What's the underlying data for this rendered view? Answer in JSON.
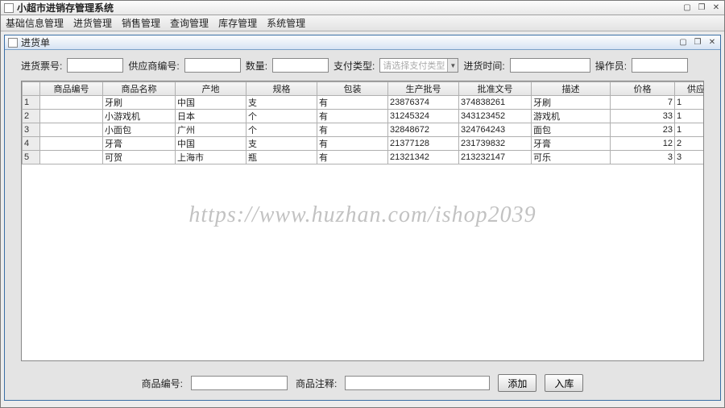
{
  "window": {
    "title": "小超市进销存管理系统",
    "min_icon": "▢",
    "restore_icon": "❐",
    "close_icon": "✕"
  },
  "menubar": {
    "items": [
      "基础信息管理",
      "进货管理",
      "销售管理",
      "查询管理",
      "库存管理",
      "系统管理"
    ]
  },
  "subwindow": {
    "title": "进货单",
    "min_icon": "▢",
    "restore_icon": "❐",
    "close_icon": "✕"
  },
  "filters": {
    "jinhuo_piaohao_label": "进货票号:",
    "jinhuo_piaohao": "",
    "gys_bianhao_label": "供应商编号:",
    "gys_bianhao": "",
    "shuliang_label": "数量:",
    "shuliang": "",
    "zhifu_leixing_label": "支付类型:",
    "zhifu_leixing_placeholder": "请选择支付类型",
    "jinhuo_shijian_label": "进货时间:",
    "jinhuo_shijian": "",
    "caozuoyuan_label": "操作员:",
    "caozuoyuan": ""
  },
  "table": {
    "columns": [
      "商品编号",
      "商品名称",
      "产地",
      "规格",
      "包装",
      "生产批号",
      "批准文号",
      "描述",
      "价格",
      "供应商编号"
    ],
    "rows": [
      {
        "n": "1",
        "id": "",
        "name": "牙刷",
        "origin": "中国",
        "spec": "支",
        "pack": "有",
        "batch": "23876374",
        "approve": "374838261",
        "desc": "牙刷",
        "price": "7",
        "supplier": "1"
      },
      {
        "n": "2",
        "id": "",
        "name": "小游戏机",
        "origin": "日本",
        "spec": "个",
        "pack": "有",
        "batch": "31245324",
        "approve": "343123452",
        "desc": "游戏机",
        "price": "33",
        "supplier": "1"
      },
      {
        "n": "3",
        "id": "",
        "name": "小面包",
        "origin": "广州",
        "spec": "个",
        "pack": "有",
        "batch": "32848672",
        "approve": "324764243",
        "desc": "面包",
        "price": "23",
        "supplier": "1"
      },
      {
        "n": "4",
        "id": "",
        "name": "牙膏",
        "origin": "中国",
        "spec": "支",
        "pack": "有",
        "batch": "21377128",
        "approve": "231739832",
        "desc": "牙膏",
        "price": "12",
        "supplier": "2"
      },
      {
        "n": "5",
        "id": "",
        "name": "可贺",
        "origin": "上海市",
        "spec": "瓶",
        "pack": "有",
        "batch": "21321342",
        "approve": "213232147",
        "desc": "可乐",
        "price": "3",
        "supplier": "3"
      }
    ]
  },
  "bottom": {
    "bianhao_label": "商品编号:",
    "bianhao": "",
    "zhushi_label": "商品注释:",
    "zhushi": "",
    "add_btn": "添加",
    "ruku_btn": "入库"
  },
  "watermark": "https://www.huzhan.com/ishop2039"
}
